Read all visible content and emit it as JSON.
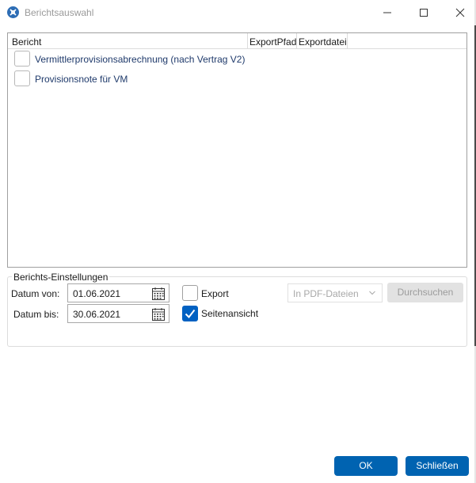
{
  "window": {
    "title": "Berichtsauswahl",
    "accent_color": "#0063b1"
  },
  "report_list": {
    "columns": [
      "Bericht",
      "ExportPfad",
      "Exportdatei"
    ],
    "rows": [
      {
        "label": "Vermittlerprovisionsabrechnung (nach Vertrag V2)",
        "checked": false
      },
      {
        "label": "Provisionsnote für VM",
        "checked": false
      }
    ]
  },
  "settings": {
    "group_label": "Berichts-Einstellungen",
    "date_from_label": "Datum von:",
    "date_from_value": "01.06.2021",
    "date_to_label": "Datum bis:",
    "date_to_value": "30.06.2021",
    "export_label": "Export",
    "export_checked": false,
    "page_view_label": "Seitenansicht",
    "page_view_checked": true,
    "format_selected": "In PDF-Dateien",
    "browse_label": "Durchsuchen"
  },
  "footer": {
    "ok_label": "OK",
    "close_label": "Schließen"
  }
}
